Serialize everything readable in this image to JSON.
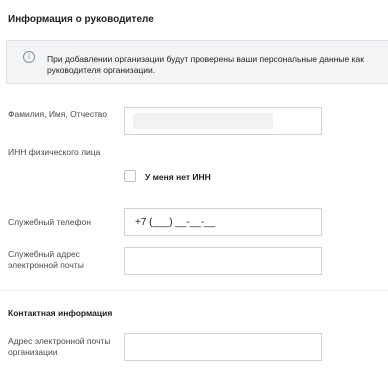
{
  "manager_section": {
    "title": "Информация о руководителе",
    "notice": "При добавлении организации будут проверены ваши персональные данные как руководителя организации."
  },
  "fields": {
    "full_name": {
      "label": "Фамилия, Имя, Отчество",
      "value": ""
    },
    "inn": {
      "label": "ИНН физического лица"
    },
    "no_inn": {
      "label": "У меня нет ИНН",
      "checked": false
    },
    "work_phone": {
      "label": "Служебный телефон",
      "value": "+7 (___) __-__-__"
    },
    "work_email": {
      "label": "Служебный адрес электронной почты",
      "value": ""
    }
  },
  "contact_section": {
    "title": "Контактная информация",
    "org_email": {
      "label": "Адрес электронной почты организации",
      "value": ""
    }
  },
  "icons": {
    "info": "info-icon"
  }
}
